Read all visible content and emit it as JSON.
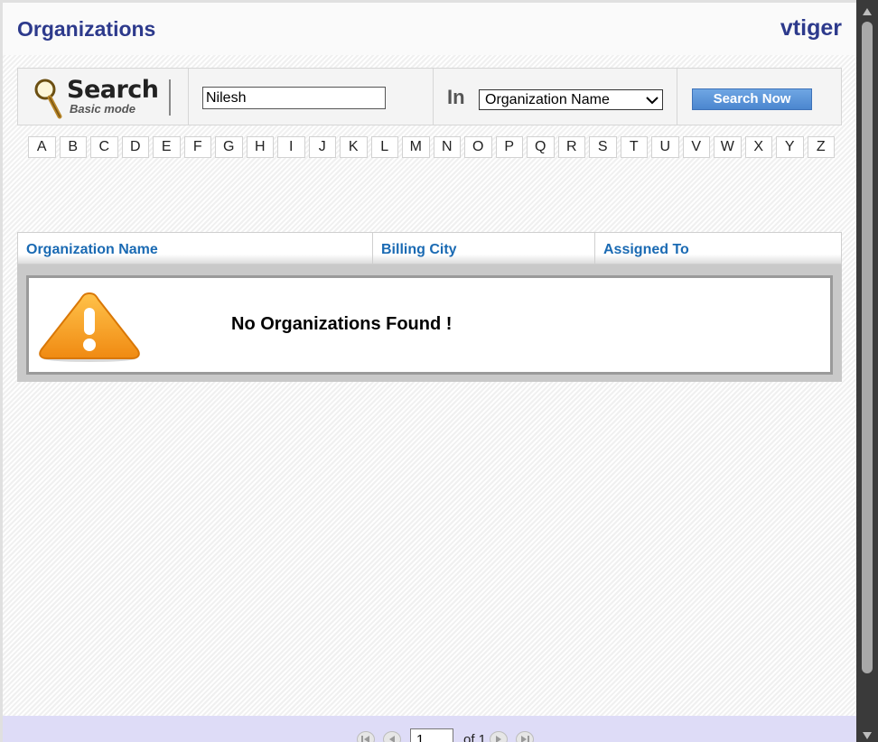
{
  "header": {
    "title": "Organizations",
    "brand": "vtiger"
  },
  "search": {
    "logo_title": "Search",
    "logo_subtitle": "Basic mode",
    "query_value": "Nilesh",
    "in_label": "In",
    "field_selected": "Organization Name",
    "button_label": "Search Now"
  },
  "alphabet": [
    "A",
    "B",
    "C",
    "D",
    "E",
    "F",
    "G",
    "H",
    "I",
    "J",
    "K",
    "L",
    "M",
    "N",
    "O",
    "P",
    "Q",
    "R",
    "S",
    "T",
    "U",
    "V",
    "W",
    "X",
    "Y",
    "Z"
  ],
  "table": {
    "columns": [
      "Organization Name",
      "Billing City",
      "Assigned To"
    ],
    "empty_message": "No Organizations Found !"
  },
  "pagination": {
    "current_page": "1",
    "of_text": "of 1"
  },
  "colors": {
    "title": "#2d3a8c",
    "column_header": "#1a6ab3",
    "button": "#4b86cf",
    "footer_bg": "#dedcf7"
  },
  "icons": {
    "search_logo": "magnifier-icon",
    "empty_state": "warning-icon",
    "pager": [
      "first-page-icon",
      "previous-page-icon",
      "next-page-icon",
      "last-page-icon"
    ]
  }
}
